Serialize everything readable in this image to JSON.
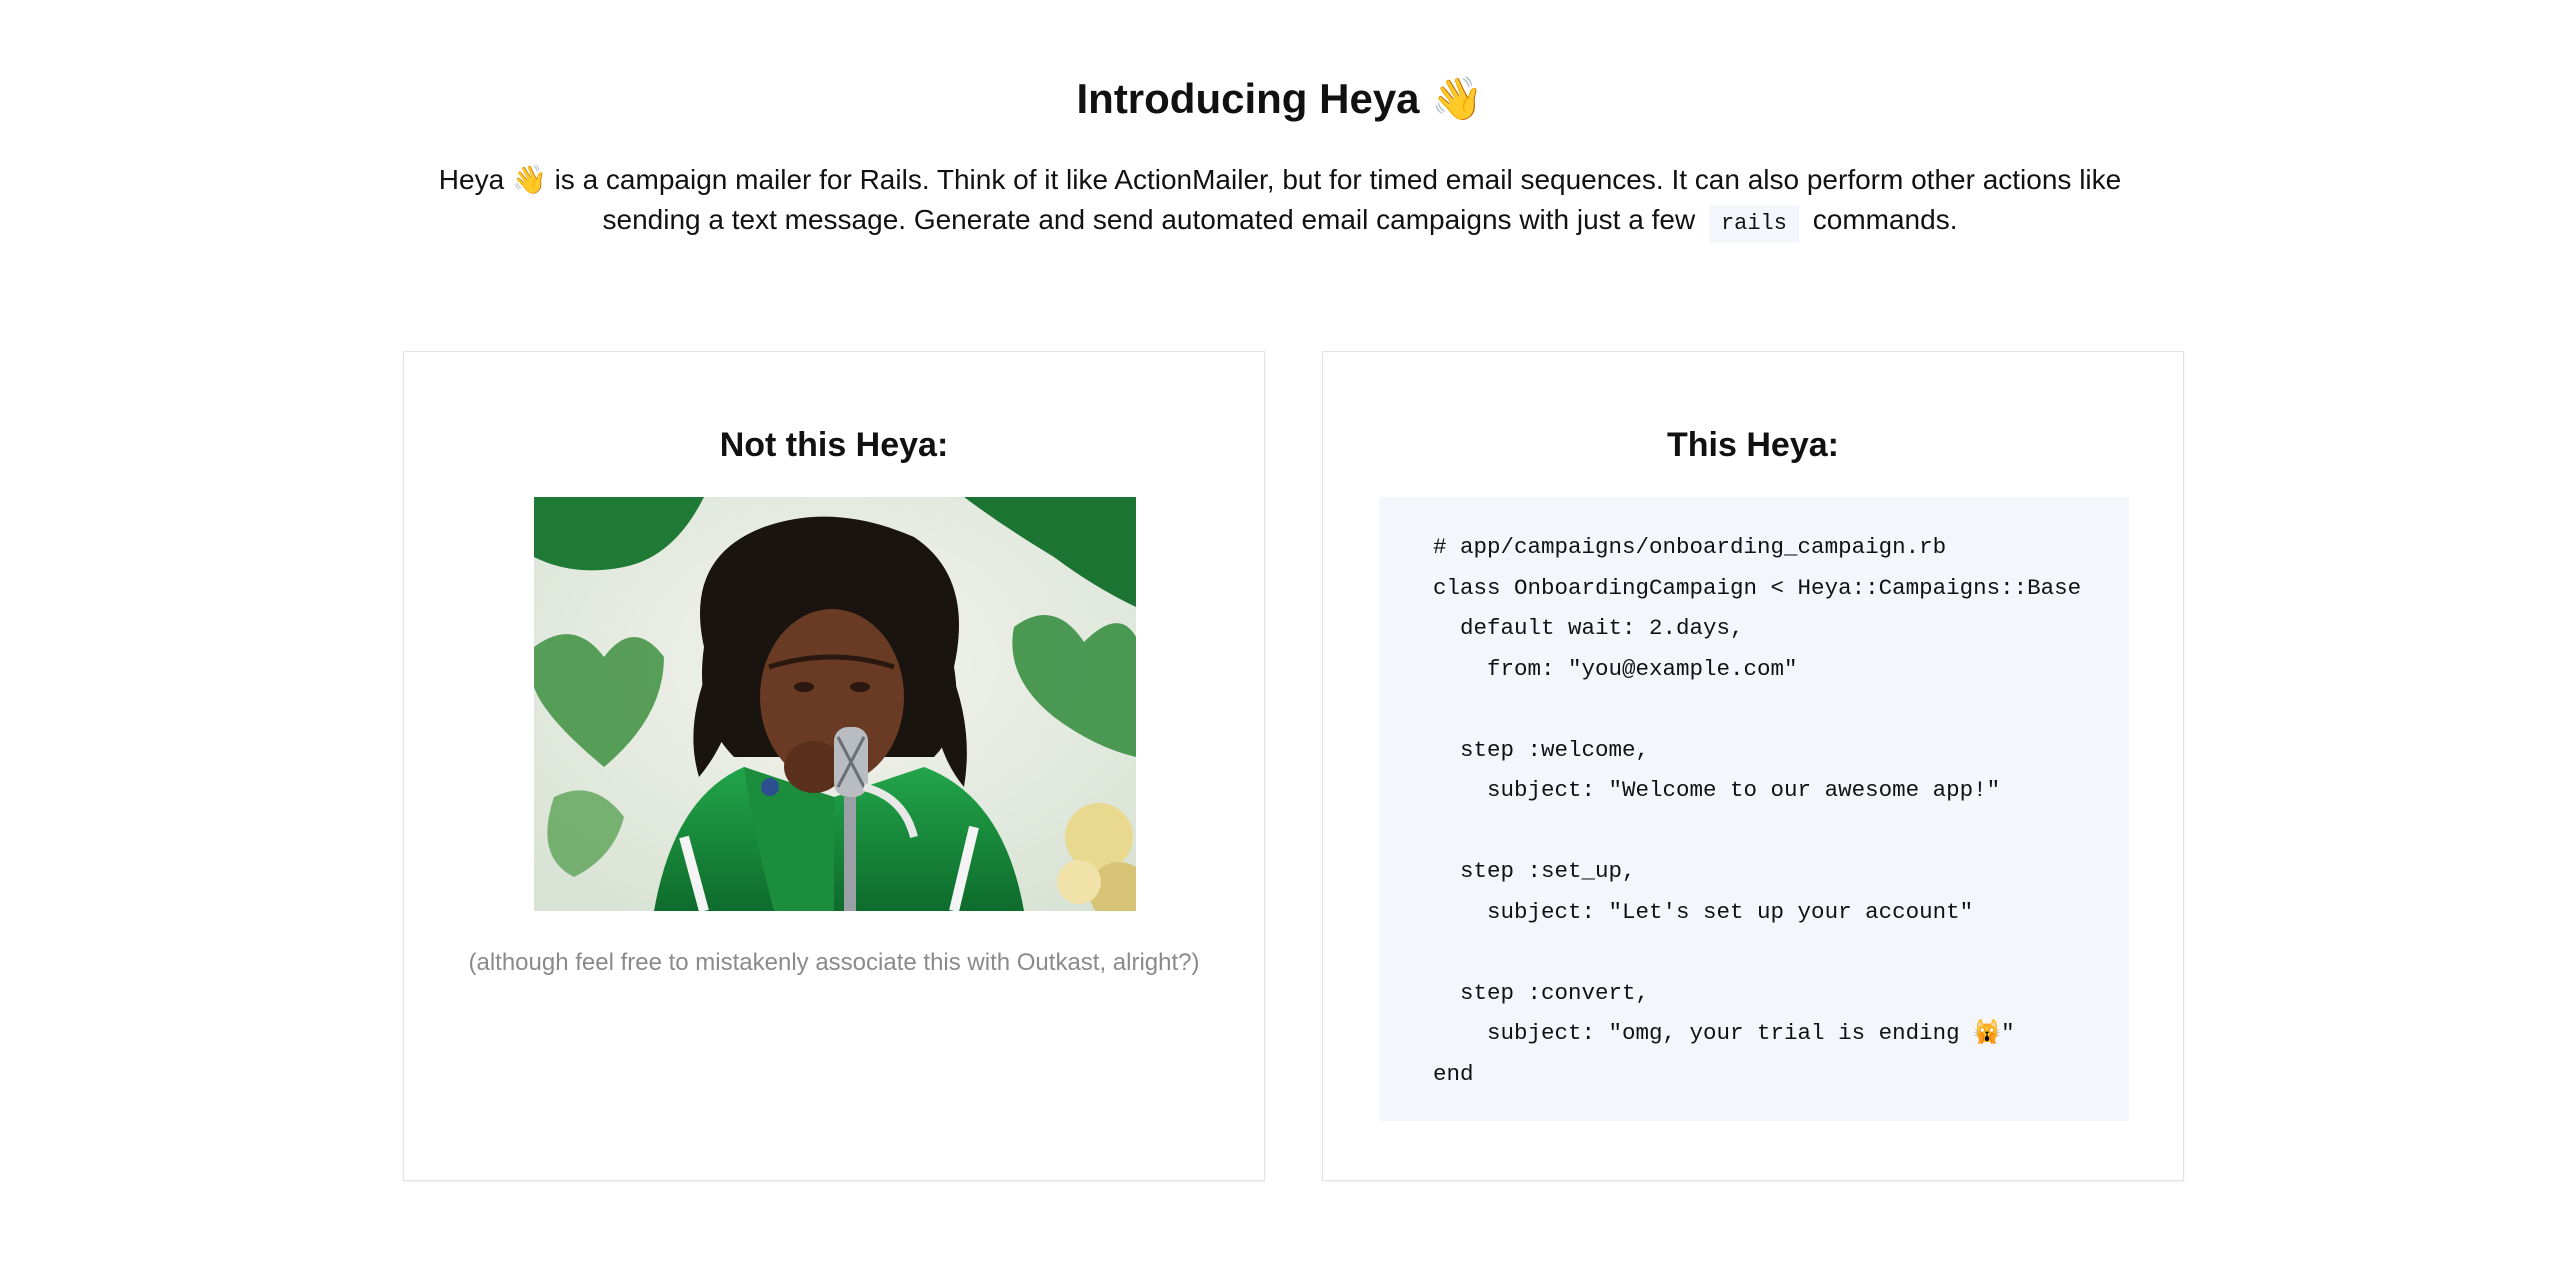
{
  "hero": {
    "title": "Introducing Heya 👋",
    "description_part1": "Heya 👋 is a campaign mailer for Rails. Think of it like ActionMailer, but for timed email sequences. It can also perform other actions like sending a text message. Generate and send automated email campaigns with just a few",
    "description_code": "rails",
    "description_part2": "commands."
  },
  "left_card": {
    "title": "Not this Heya:",
    "image_alt": "Animated gif of a singer in a green jacket performing into a microphone",
    "caption": "(although feel free to mistakenly associate this with Outkast, alright?)"
  },
  "right_card": {
    "title": "This Heya:",
    "code_lines": [
      "# app/campaigns/onboarding_campaign.rb",
      "class OnboardingCampaign < Heya::Campaigns::Base",
      "  default wait: 2.days,",
      "    from: \"you@example.com\"",
      "",
      "  step :welcome,",
      "    subject: \"Welcome to our awesome app!\"",
      "",
      "  step :set_up,",
      "    subject: \"Let's set up your account\"",
      "",
      "  step :convert,",
      "    subject: \"omg, your trial is ending 🙀\"",
      "end"
    ]
  },
  "colors": {
    "code_background": "#f3f7fb",
    "caption_text": "#8a8a8a",
    "card_border": "#e3e3e3"
  }
}
